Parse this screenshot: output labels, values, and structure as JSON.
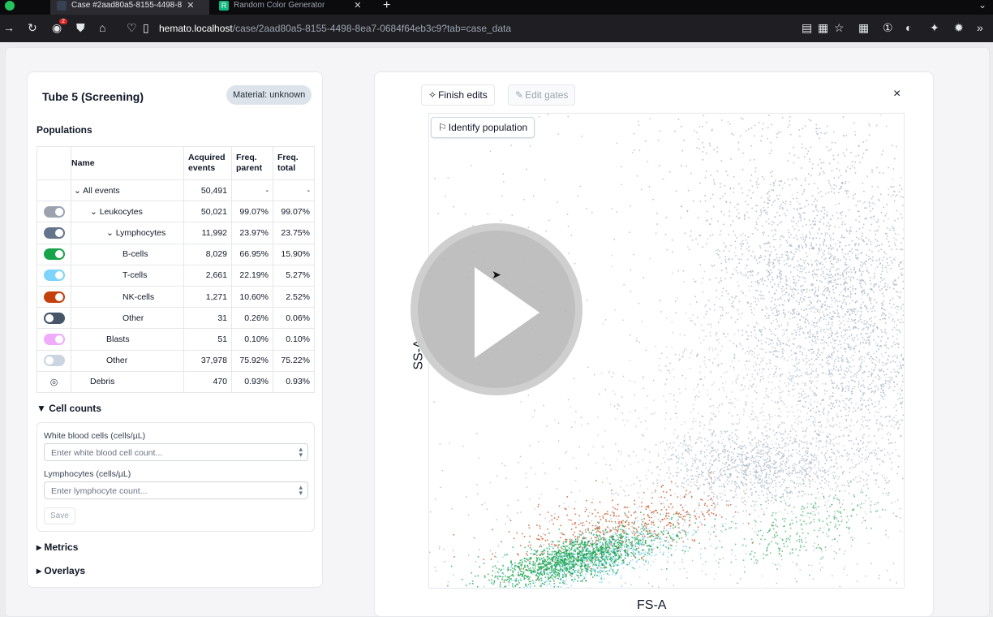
{
  "browser": {
    "tabs": [
      {
        "label": "Case #2aad80a5-8155-4498-8",
        "active": true
      },
      {
        "label": "Random Color Generator",
        "active": false
      }
    ],
    "url_host": "hemato.localhost",
    "url_path": "/case/2aad80a5-8155-4498-8ea7-0684f64eb3c9?tab=case_data",
    "notification_count": "2"
  },
  "left_panel": {
    "title": "Tube 5 (Screening)",
    "material": "Material: unknown",
    "populations_heading": "Populations",
    "columns": [
      "Name",
      "Acquired events",
      "Freq. parent",
      "Freq. total"
    ],
    "rows": [
      {
        "name": "All events",
        "indent": 1,
        "expander": "⌄",
        "control": "none",
        "color": "",
        "events": "50,491",
        "parent": "-",
        "total": "-"
      },
      {
        "name": "Leukocytes",
        "indent": 2,
        "expander": "⌄",
        "control": "toggle",
        "color": "#9ca3af",
        "events": "50,021",
        "parent": "99.07%",
        "total": "99.07%"
      },
      {
        "name": "Lymphocytes",
        "indent": 3,
        "expander": "⌄",
        "control": "toggle",
        "color": "#64748b",
        "events": "11,992",
        "parent": "23.97%",
        "total": "23.75%"
      },
      {
        "name": "B-cells",
        "indent": 4,
        "expander": "",
        "control": "toggle",
        "color": "#16a34a",
        "events": "8,029",
        "parent": "66.95%",
        "total": "15.90%"
      },
      {
        "name": "T-cells",
        "indent": 4,
        "expander": "",
        "control": "toggle",
        "color": "#7dd3fc",
        "events": "2,661",
        "parent": "22.19%",
        "total": "5.27%"
      },
      {
        "name": "NK-cells",
        "indent": 4,
        "expander": "",
        "control": "toggle",
        "color": "#c2410c",
        "events": "1,271",
        "parent": "10.60%",
        "total": "2.52%"
      },
      {
        "name": "Other",
        "indent": 4,
        "expander": "",
        "control": "toggle-off",
        "color": "#475569",
        "events": "31",
        "parent": "0.26%",
        "total": "0.06%"
      },
      {
        "name": "Blasts",
        "indent": 3,
        "expander": "",
        "control": "toggle",
        "color": "#f0abfc",
        "events": "51",
        "parent": "0.10%",
        "total": "0.10%"
      },
      {
        "name": "Other",
        "indent": 3,
        "expander": "",
        "control": "toggle-off",
        "color": "#cbd5e1",
        "events": "37,978",
        "parent": "75.92%",
        "total": "75.22%"
      },
      {
        "name": "Debris",
        "indent": 2,
        "expander": "",
        "control": "eye",
        "color": "",
        "events": "470",
        "parent": "0.93%",
        "total": "0.93%"
      }
    ],
    "cell_counts": {
      "heading": "Cell counts",
      "wbc_label": "White blood cells (cells/µL)",
      "wbc_placeholder": "Enter white blood cell count...",
      "lymph_label": "Lymphocytes (cells/µL)",
      "lymph_placeholder": "Enter lymphocyte count...",
      "save_label": "Save"
    },
    "metrics_heading": "Metrics",
    "overlays_heading": "Overlays"
  },
  "right_panel": {
    "finish_edits": "Finish edits",
    "edit_gates": "Edit gates",
    "identify_population": "Identify population",
    "x_axis": "FS-A",
    "y_axis": "SS-A",
    "close": "×"
  },
  "icons": {
    "finish_edits": "sparkle-icon",
    "edit_gates": "edit-icon",
    "identify_population": "flag-icon",
    "play": "play-icon"
  }
}
